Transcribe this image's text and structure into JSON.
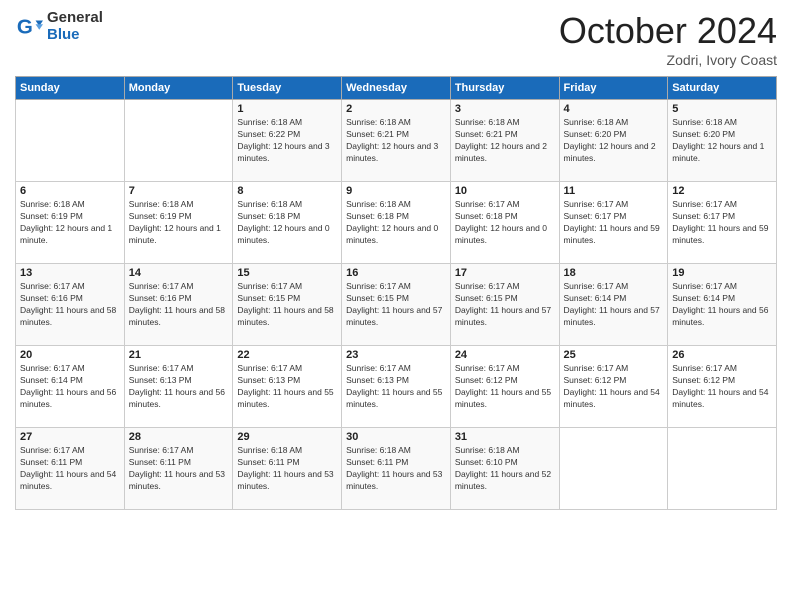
{
  "logo": {
    "general": "General",
    "blue": "Blue"
  },
  "title": "October 2024",
  "subtitle": "Zodri, Ivory Coast",
  "days_of_week": [
    "Sunday",
    "Monday",
    "Tuesday",
    "Wednesday",
    "Thursday",
    "Friday",
    "Saturday"
  ],
  "weeks": [
    [
      {
        "day": "",
        "info": ""
      },
      {
        "day": "",
        "info": ""
      },
      {
        "day": "1",
        "info": "Sunrise: 6:18 AM\nSunset: 6:22 PM\nDaylight: 12 hours and 3 minutes."
      },
      {
        "day": "2",
        "info": "Sunrise: 6:18 AM\nSunset: 6:21 PM\nDaylight: 12 hours and 3 minutes."
      },
      {
        "day": "3",
        "info": "Sunrise: 6:18 AM\nSunset: 6:21 PM\nDaylight: 12 hours and 2 minutes."
      },
      {
        "day": "4",
        "info": "Sunrise: 6:18 AM\nSunset: 6:20 PM\nDaylight: 12 hours and 2 minutes."
      },
      {
        "day": "5",
        "info": "Sunrise: 6:18 AM\nSunset: 6:20 PM\nDaylight: 12 hours and 1 minute."
      }
    ],
    [
      {
        "day": "6",
        "info": "Sunrise: 6:18 AM\nSunset: 6:19 PM\nDaylight: 12 hours and 1 minute."
      },
      {
        "day": "7",
        "info": "Sunrise: 6:18 AM\nSunset: 6:19 PM\nDaylight: 12 hours and 1 minute."
      },
      {
        "day": "8",
        "info": "Sunrise: 6:18 AM\nSunset: 6:18 PM\nDaylight: 12 hours and 0 minutes."
      },
      {
        "day": "9",
        "info": "Sunrise: 6:18 AM\nSunset: 6:18 PM\nDaylight: 12 hours and 0 minutes."
      },
      {
        "day": "10",
        "info": "Sunrise: 6:17 AM\nSunset: 6:18 PM\nDaylight: 12 hours and 0 minutes."
      },
      {
        "day": "11",
        "info": "Sunrise: 6:17 AM\nSunset: 6:17 PM\nDaylight: 11 hours and 59 minutes."
      },
      {
        "day": "12",
        "info": "Sunrise: 6:17 AM\nSunset: 6:17 PM\nDaylight: 11 hours and 59 minutes."
      }
    ],
    [
      {
        "day": "13",
        "info": "Sunrise: 6:17 AM\nSunset: 6:16 PM\nDaylight: 11 hours and 58 minutes."
      },
      {
        "day": "14",
        "info": "Sunrise: 6:17 AM\nSunset: 6:16 PM\nDaylight: 11 hours and 58 minutes."
      },
      {
        "day": "15",
        "info": "Sunrise: 6:17 AM\nSunset: 6:15 PM\nDaylight: 11 hours and 58 minutes."
      },
      {
        "day": "16",
        "info": "Sunrise: 6:17 AM\nSunset: 6:15 PM\nDaylight: 11 hours and 57 minutes."
      },
      {
        "day": "17",
        "info": "Sunrise: 6:17 AM\nSunset: 6:15 PM\nDaylight: 11 hours and 57 minutes."
      },
      {
        "day": "18",
        "info": "Sunrise: 6:17 AM\nSunset: 6:14 PM\nDaylight: 11 hours and 57 minutes."
      },
      {
        "day": "19",
        "info": "Sunrise: 6:17 AM\nSunset: 6:14 PM\nDaylight: 11 hours and 56 minutes."
      }
    ],
    [
      {
        "day": "20",
        "info": "Sunrise: 6:17 AM\nSunset: 6:14 PM\nDaylight: 11 hours and 56 minutes."
      },
      {
        "day": "21",
        "info": "Sunrise: 6:17 AM\nSunset: 6:13 PM\nDaylight: 11 hours and 56 minutes."
      },
      {
        "day": "22",
        "info": "Sunrise: 6:17 AM\nSunset: 6:13 PM\nDaylight: 11 hours and 55 minutes."
      },
      {
        "day": "23",
        "info": "Sunrise: 6:17 AM\nSunset: 6:13 PM\nDaylight: 11 hours and 55 minutes."
      },
      {
        "day": "24",
        "info": "Sunrise: 6:17 AM\nSunset: 6:12 PM\nDaylight: 11 hours and 55 minutes."
      },
      {
        "day": "25",
        "info": "Sunrise: 6:17 AM\nSunset: 6:12 PM\nDaylight: 11 hours and 54 minutes."
      },
      {
        "day": "26",
        "info": "Sunrise: 6:17 AM\nSunset: 6:12 PM\nDaylight: 11 hours and 54 minutes."
      }
    ],
    [
      {
        "day": "27",
        "info": "Sunrise: 6:17 AM\nSunset: 6:11 PM\nDaylight: 11 hours and 54 minutes."
      },
      {
        "day": "28",
        "info": "Sunrise: 6:17 AM\nSunset: 6:11 PM\nDaylight: 11 hours and 53 minutes."
      },
      {
        "day": "29",
        "info": "Sunrise: 6:18 AM\nSunset: 6:11 PM\nDaylight: 11 hours and 53 minutes."
      },
      {
        "day": "30",
        "info": "Sunrise: 6:18 AM\nSunset: 6:11 PM\nDaylight: 11 hours and 53 minutes."
      },
      {
        "day": "31",
        "info": "Sunrise: 6:18 AM\nSunset: 6:10 PM\nDaylight: 11 hours and 52 minutes."
      },
      {
        "day": "",
        "info": ""
      },
      {
        "day": "",
        "info": ""
      }
    ]
  ]
}
